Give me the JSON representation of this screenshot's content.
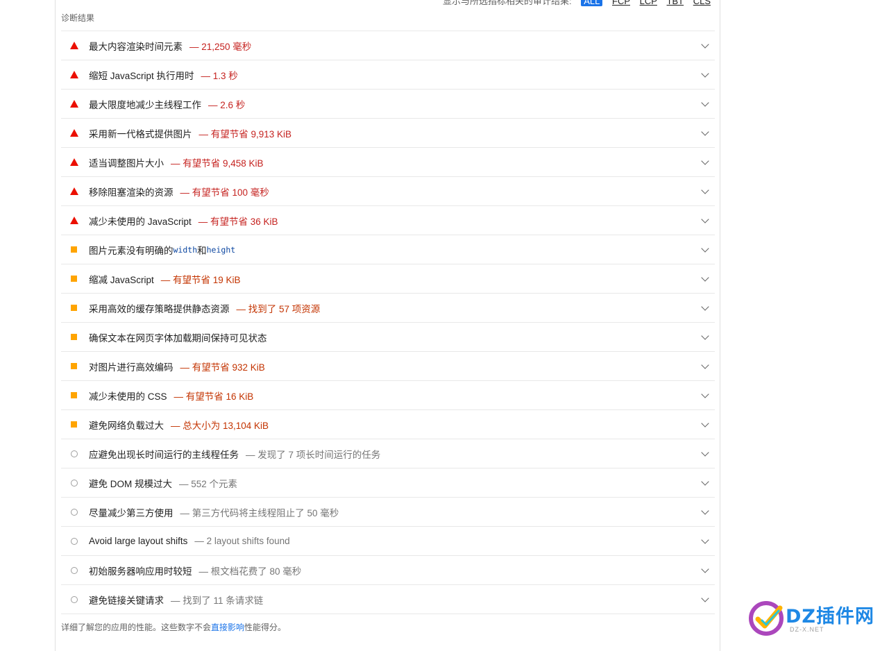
{
  "topbar": {
    "partial_text": "显示与所选指标相关的审计结果:",
    "filters": [
      "ALL",
      "FCP",
      "LCP",
      "TBT",
      "CLS"
    ]
  },
  "section_title": "诊断结果",
  "rows": [
    {
      "severity": "fail",
      "title": "最大内容渲染时间元素",
      "display": "— 21,250 毫秒"
    },
    {
      "severity": "fail",
      "title": "缩短 JavaScript 执行用时",
      "display": "— 1.3 秒"
    },
    {
      "severity": "fail",
      "title": "最大限度地减少主线程工作",
      "display": "— 2.6 秒"
    },
    {
      "severity": "fail",
      "title": "采用新一代格式提供图片",
      "display": "— 有望节省 9,913 KiB"
    },
    {
      "severity": "fail",
      "title": "适当调整图片大小",
      "display": "— 有望节省 9,458 KiB"
    },
    {
      "severity": "fail",
      "title": "移除阻塞渲染的资源",
      "display": "— 有望节省 100 毫秒"
    },
    {
      "severity": "fail",
      "title": "减少未使用的 JavaScript",
      "display": "— 有望节省 36 KiB"
    },
    {
      "severity": "average",
      "title": "图片元素没有明确的",
      "code1": "width",
      "mid": "和",
      "code2": "height",
      "display": ""
    },
    {
      "severity": "average",
      "title": "缩减 JavaScript",
      "display": "— 有望节省 19 KiB"
    },
    {
      "severity": "average",
      "title": "采用高效的缓存策略提供静态资源",
      "display": "— 找到了 57 项资源"
    },
    {
      "severity": "average",
      "title": "确保文本在网页字体加载期间保持可见状态",
      "display": ""
    },
    {
      "severity": "average",
      "title": "对图片进行高效编码",
      "display": "— 有望节省 932 KiB"
    },
    {
      "severity": "average",
      "title": "减少未使用的 CSS",
      "display": "— 有望节省 16 KiB"
    },
    {
      "severity": "average",
      "title": "避免网络负载过大",
      "display": "— 总大小为 13,104 KiB"
    },
    {
      "severity": "info",
      "title": "应避免出现长时间运行的主线程任务",
      "display": "— 发现了 7 项长时间运行的任务"
    },
    {
      "severity": "info",
      "title": "避免 DOM 规模过大",
      "display": "— 552 个元素"
    },
    {
      "severity": "info",
      "title": "尽量减少第三方使用",
      "display": "— 第三方代码将主线程阻止了 50 毫秒"
    },
    {
      "severity": "info",
      "title": "Avoid large layout shifts",
      "display": "— 2 layout shifts found"
    },
    {
      "severity": "info",
      "title": "初始服务器响应用时较短",
      "display": "— 根文档花费了 80 毫秒"
    },
    {
      "severity": "info",
      "title": "避免链接关键请求",
      "display": "— 找到了 11 条请求链"
    }
  ],
  "footer": {
    "before": "详细了解您的应用的性能。这些数字不会",
    "link": "直接影响",
    "after": "性能得分。"
  },
  "watermark": {
    "brand": "DZ插件网",
    "url": "DZ-X.NET"
  },
  "colors": {
    "fail": "#eb0f00",
    "average": "#ffa400",
    "info": "#9e9e9e",
    "link": "#1a73e8"
  }
}
